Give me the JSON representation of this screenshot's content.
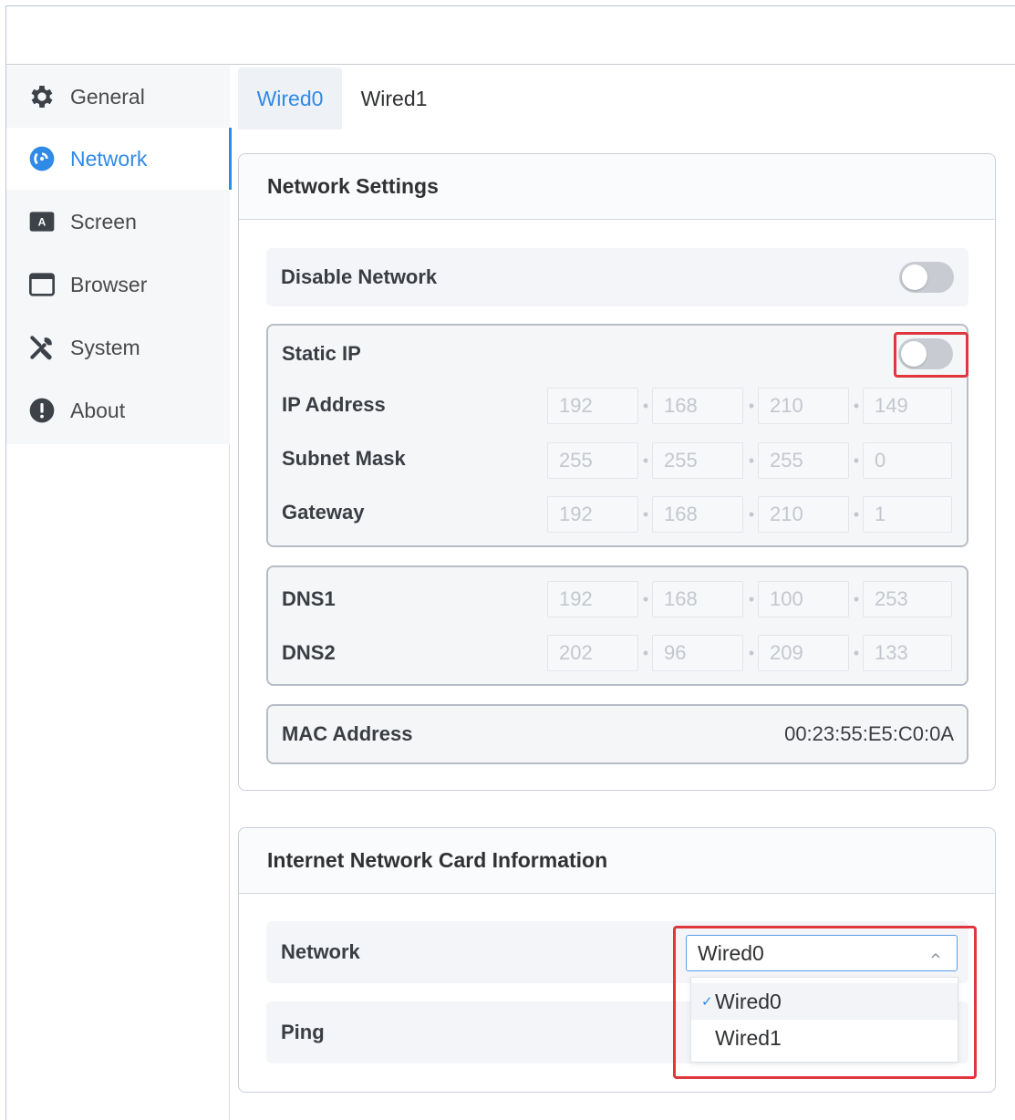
{
  "sidebar": {
    "items": [
      {
        "label": "General",
        "icon": "gear-icon"
      },
      {
        "label": "Network",
        "icon": "network-icon",
        "active": true
      },
      {
        "label": "Screen",
        "icon": "screen-icon"
      },
      {
        "label": "Browser",
        "icon": "browser-window-icon"
      },
      {
        "label": "System",
        "icon": "tools-icon"
      },
      {
        "label": "About",
        "icon": "info-alert-icon"
      }
    ]
  },
  "tabs": [
    {
      "label": "Wired0",
      "active": true
    },
    {
      "label": "Wired1",
      "active": false
    }
  ],
  "network_settings": {
    "title": "Network Settings",
    "disable_network": {
      "label": "Disable Network",
      "enabled": false
    },
    "static_ip": {
      "label": "Static IP",
      "enabled": false
    },
    "ip_address": {
      "label": "IP Address",
      "octets": [
        "192",
        "168",
        "210",
        "149"
      ]
    },
    "subnet_mask": {
      "label": "Subnet Mask",
      "octets": [
        "255",
        "255",
        "255",
        "0"
      ]
    },
    "gateway": {
      "label": "Gateway",
      "octets": [
        "192",
        "168",
        "210",
        "1"
      ]
    },
    "dns1": {
      "label": "DNS1",
      "octets": [
        "192",
        "168",
        "100",
        "253"
      ]
    },
    "dns2": {
      "label": "DNS2",
      "octets": [
        "202",
        "96",
        "209",
        "133"
      ]
    },
    "mac": {
      "label": "MAC Address",
      "value": "00:23:55:E5:C0:0A"
    }
  },
  "card_info": {
    "title": "Internet Network Card Information",
    "network": {
      "label": "Network",
      "selected": "Wired0",
      "options": [
        "Wired0",
        "Wired1"
      ]
    },
    "ping": {
      "label": "Ping"
    }
  },
  "colors": {
    "accent": "#2f8ae8",
    "highlight": "#e0373d",
    "toggle_off": "#c8ccd2"
  }
}
